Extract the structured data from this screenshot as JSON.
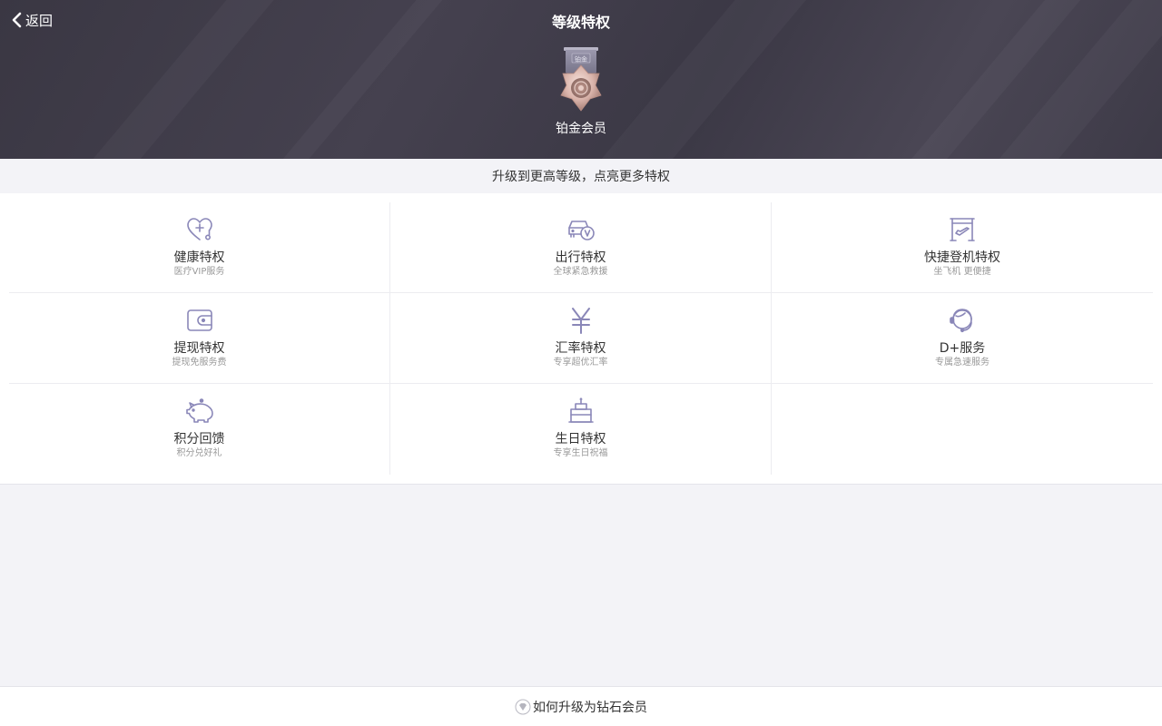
{
  "header": {
    "back_label": "返回",
    "title": "等级特权",
    "level_name": "铂金会员",
    "medal_label": "铂金"
  },
  "hint": "升级到更高等级，点亮更多特权",
  "privileges": [
    {
      "title": "健康特权",
      "sub": "医疗VIP服务",
      "icon": "stethoscope-heart-icon"
    },
    {
      "title": "出行特权",
      "sub": "全球紧急救援",
      "icon": "car-vip-icon"
    },
    {
      "title": "快捷登机特权",
      "sub": "坐飞机 更便捷",
      "icon": "boarding-gate-icon"
    },
    {
      "title": "提现特权",
      "sub": "提现免服务费",
      "icon": "wallet-icon"
    },
    {
      "title": "汇率特权",
      "sub": "专享超优汇率",
      "icon": "yen-icon"
    },
    {
      "title": "D+服务",
      "sub": "专属急速服务",
      "icon": "headset-agent-icon"
    },
    {
      "title": "积分回馈",
      "sub": "积分兑好礼",
      "icon": "piggy-bank-icon"
    },
    {
      "title": "生日特权",
      "sub": "专享生日祝福",
      "icon": "birthday-cake-icon"
    }
  ],
  "footer": {
    "link_label": "如何升级为钻石会员",
    "icon": "diamond-icon"
  },
  "colors": {
    "header_bg": "#3f3c48",
    "icon_color": "#8a87b8",
    "page_bg": "#f3f3f7"
  }
}
